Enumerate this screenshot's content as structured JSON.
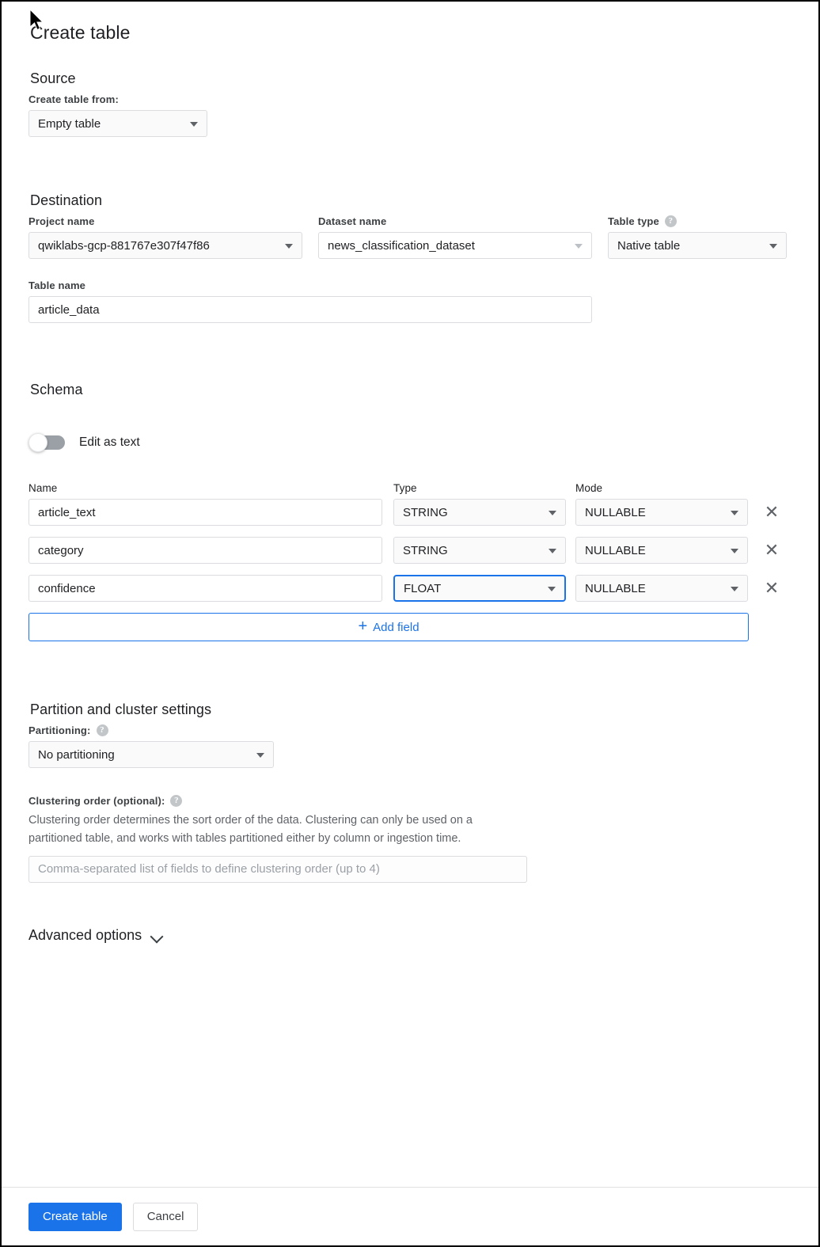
{
  "dialog": {
    "title": "Create table"
  },
  "source": {
    "heading": "Source",
    "create_table_from_label": "Create table from:",
    "create_table_from_value": "Empty table"
  },
  "destination": {
    "heading": "Destination",
    "project_label": "Project name",
    "project_value": "qwiklabs-gcp-881767e307f47f86",
    "dataset_label": "Dataset name",
    "dataset_value": "news_classification_dataset",
    "table_type_label": "Table type",
    "table_type_value": "Native table",
    "table_name_label": "Table name",
    "table_name_value": "article_data"
  },
  "schema": {
    "heading": "Schema",
    "edit_as_text_label": "Edit as text",
    "edit_as_text_on": false,
    "columns": {
      "name": "Name",
      "type": "Type",
      "mode": "Mode"
    },
    "fields": [
      {
        "name": "article_text",
        "type": "STRING",
        "mode": "NULLABLE",
        "remove_icon": "close-icon",
        "type_focused": false
      },
      {
        "name": "category",
        "type": "STRING",
        "mode": "NULLABLE",
        "remove_icon": "close-icon",
        "type_focused": false
      },
      {
        "name": "confidence",
        "type": "FLOAT",
        "mode": "NULLABLE",
        "remove_icon": "close-icon",
        "type_focused": true
      }
    ],
    "add_field_label": "Add field",
    "add_field_icon": "plus-icon"
  },
  "partition": {
    "heading": "Partition and cluster settings",
    "partitioning_label": "Partitioning:",
    "partitioning_value": "No partitioning",
    "clustering_label": "Clustering order (optional):",
    "clustering_description": "Clustering order determines the sort order of the data. Clustering can only be used on a partitioned table, and works with tables partitioned either by column or ingestion time.",
    "clustering_placeholder": "Comma-separated list of fields to define clustering order (up to 4)",
    "clustering_value": ""
  },
  "advanced": {
    "label": "Advanced options",
    "chevron_icon": "chevron-down-icon",
    "expanded": false
  },
  "footer": {
    "create_label": "Create table",
    "cancel_label": "Cancel"
  },
  "colors": {
    "accent": "#1a73e8",
    "border": "#dadce0",
    "text": "#202124",
    "muted_text": "#5f6368",
    "field_bg": "#fafafa"
  },
  "icons": {
    "help": "?",
    "close": "✕",
    "plus": "+"
  }
}
